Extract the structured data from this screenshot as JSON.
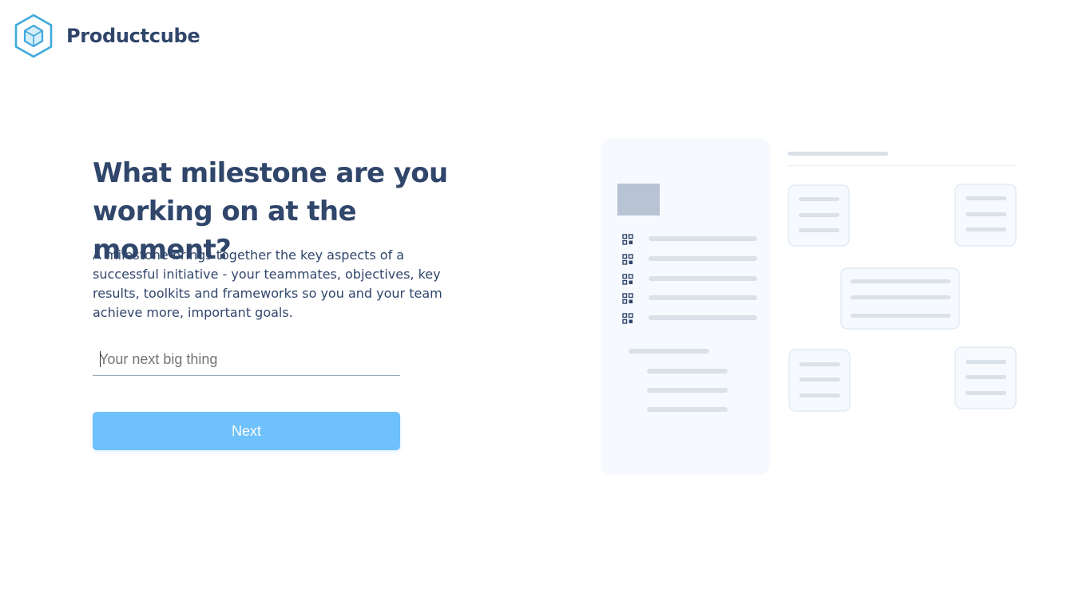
{
  "brand": {
    "name": "Productcube",
    "logo_icon": "hexagon-cube-logo",
    "color": "#30466b",
    "accent": "#3fa9dd"
  },
  "main": {
    "headline": "What milestone are you working on at the moment?",
    "description": "A milestone brings together the key aspects of a successful initiative - your teammates, objectives, key results, toolkits and frameworks so you and your team achieve more, important goals.",
    "input": {
      "placeholder": "Your next big thing",
      "value": ""
    },
    "next_label": "Next",
    "button_color": "#6ec1fb"
  },
  "illustration": {
    "icon": "grid-icon",
    "panel_color": "#f6f9fd"
  }
}
